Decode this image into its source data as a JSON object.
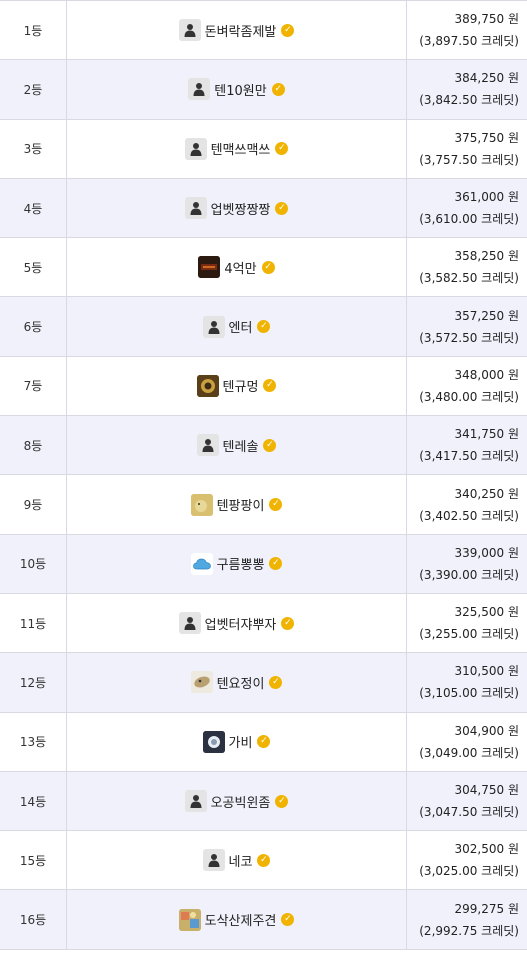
{
  "rows": [
    {
      "rank": "1등",
      "name": "돈벼락좀제발",
      "avatar": "default",
      "amount": "389,750 원",
      "credits": "(3,897.50 크레딧)"
    },
    {
      "rank": "2등",
      "name": "텐10원만",
      "avatar": "default",
      "amount": "384,250 원",
      "credits": "(3,842.50 크레딧)"
    },
    {
      "rank": "3등",
      "name": "텐맥쓰맥쓰",
      "avatar": "default",
      "amount": "375,750 원",
      "credits": "(3,757.50 크레딧)"
    },
    {
      "rank": "4등",
      "name": "업벳짱짱짱",
      "avatar": "default",
      "amount": "361,000 원",
      "credits": "(3,610.00 크레딧)"
    },
    {
      "rank": "5등",
      "name": "4억만",
      "avatar": "dark",
      "amount": "358,250 원",
      "credits": "(3,582.50 크레딧)"
    },
    {
      "rank": "6등",
      "name": "엔터",
      "avatar": "default",
      "amount": "357,250 원",
      "credits": "(3,572.50 크레딧)"
    },
    {
      "rank": "7등",
      "name": "텐규멍",
      "avatar": "gold",
      "amount": "348,000 원",
      "credits": "(3,480.00 크레딧)"
    },
    {
      "rank": "8등",
      "name": "텐레솔",
      "avatar": "default",
      "amount": "341,750 원",
      "credits": "(3,417.50 크레딧)"
    },
    {
      "rank": "9등",
      "name": "텐팡팡이",
      "avatar": "mustard",
      "amount": "340,250 원",
      "credits": "(3,402.50 크레딧)"
    },
    {
      "rank": "10등",
      "name": "구름뽕뽕",
      "avatar": "cloud",
      "amount": "339,000 원",
      "credits": "(3,390.00 크레딧)"
    },
    {
      "rank": "11등",
      "name": "업벳터쟈뿌자",
      "avatar": "default",
      "amount": "325,500 원",
      "credits": "(3,255.00 크레딧)"
    },
    {
      "rank": "12등",
      "name": "텐요정이",
      "avatar": "tan",
      "amount": "310,500 원",
      "credits": "(3,105.00 크레딧)"
    },
    {
      "rank": "13등",
      "name": "가비",
      "avatar": "navy",
      "amount": "304,900 원",
      "credits": "(3,049.00 크레딧)"
    },
    {
      "rank": "14등",
      "name": "오공빅윈좀",
      "avatar": "default",
      "amount": "304,750 원",
      "credits": "(3,047.50 크레딧)"
    },
    {
      "rank": "15등",
      "name": "네코",
      "avatar": "default",
      "amount": "302,500 원",
      "credits": "(3,025.00 크레딧)"
    },
    {
      "rank": "16등",
      "name": "도삭산제주견",
      "avatar": "colorful",
      "amount": "299,275 원",
      "credits": "(2,992.75 크레딧)"
    }
  ],
  "colors": {
    "row_alt": "#f1f1fb",
    "border": "#d9d9e3",
    "verified": "#f0b400"
  },
  "icons": {
    "avatar": "user-avatar-icon",
    "verified": "verified-badge-icon"
  }
}
